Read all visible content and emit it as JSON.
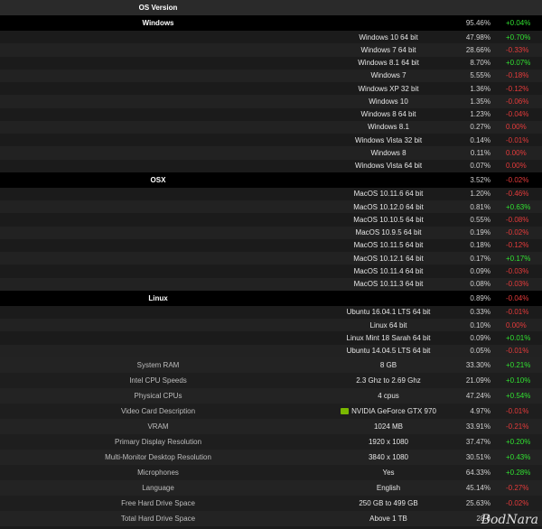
{
  "header": {
    "title": "OS Version"
  },
  "sections": [
    {
      "name": "Windows",
      "pct": "95.46%",
      "change": "+0.04%",
      "rows": [
        {
          "name": "Windows 10 64 bit",
          "pct": "47.98%",
          "change": "+0.70%"
        },
        {
          "name": "Windows 7 64 bit",
          "pct": "28.66%",
          "change": "-0.33%"
        },
        {
          "name": "Windows 8.1 64 bit",
          "pct": "8.70%",
          "change": "+0.07%"
        },
        {
          "name": "Windows 7",
          "pct": "5.55%",
          "change": "-0.18%"
        },
        {
          "name": "Windows XP 32 bit",
          "pct": "1.36%",
          "change": "-0.12%"
        },
        {
          "name": "Windows 10",
          "pct": "1.35%",
          "change": "-0.06%"
        },
        {
          "name": "Windows 8 64 bit",
          "pct": "1.23%",
          "change": "-0.04%"
        },
        {
          "name": "Windows 8.1",
          "pct": "0.27%",
          "change": "0.00%"
        },
        {
          "name": "Windows Vista 32 bit",
          "pct": "0.14%",
          "change": "-0.01%"
        },
        {
          "name": "Windows 8",
          "pct": "0.11%",
          "change": "0.00%"
        },
        {
          "name": "Windows Vista 64 bit",
          "pct": "0.07%",
          "change": "0.00%"
        }
      ]
    },
    {
      "name": "OSX",
      "pct": "3.52%",
      "change": "-0.02%",
      "rows": [
        {
          "name": "MacOS 10.11.6 64 bit",
          "pct": "1.20%",
          "change": "-0.46%"
        },
        {
          "name": "MacOS 10.12.0 64 bit",
          "pct": "0.81%",
          "change": "+0.63%"
        },
        {
          "name": "MacOS 10.10.5 64 bit",
          "pct": "0.55%",
          "change": "-0.08%"
        },
        {
          "name": "MacOS 10.9.5 64 bit",
          "pct": "0.19%",
          "change": "-0.02%"
        },
        {
          "name": "MacOS 10.11.5 64 bit",
          "pct": "0.18%",
          "change": "-0.12%"
        },
        {
          "name": "MacOS 10.12.1 64 bit",
          "pct": "0.17%",
          "change": "+0.17%"
        },
        {
          "name": "MacOS 10.11.4 64 bit",
          "pct": "0.09%",
          "change": "-0.03%"
        },
        {
          "name": "MacOS 10.11.3 64 bit",
          "pct": "0.08%",
          "change": "-0.03%"
        }
      ]
    },
    {
      "name": "Linux",
      "pct": "0.89%",
      "change": "-0.04%",
      "rows": [
        {
          "name": "Ubuntu 16.04.1 LTS 64 bit",
          "pct": "0.33%",
          "change": "-0.01%"
        },
        {
          "name": "Linux 64 bit",
          "pct": "0.10%",
          "change": "0.00%"
        },
        {
          "name": "Linux Mint 18 Sarah 64 bit",
          "pct": "0.09%",
          "change": "+0.01%"
        },
        {
          "name": "Ubuntu 14.04.5 LTS 64 bit",
          "pct": "0.05%",
          "change": "-0.01%"
        }
      ]
    }
  ],
  "summary": [
    {
      "metric": "System RAM",
      "value": "8 GB",
      "pct": "33.30%",
      "change": "+0.21%"
    },
    {
      "metric": "Intel CPU Speeds",
      "value": "2.3 Ghz to 2.69 Ghz",
      "pct": "21.09%",
      "change": "+0.10%"
    },
    {
      "metric": "Physical CPUs",
      "value": "4 cpus",
      "pct": "47.24%",
      "change": "+0.54%"
    },
    {
      "metric": "Video Card Description",
      "value": "NVIDIA GeForce GTX 970",
      "pct": "4.97%",
      "change": "-0.01%",
      "icon": "nvidia-icon"
    },
    {
      "metric": "VRAM",
      "value": "1024 MB",
      "pct": "33.91%",
      "change": "-0.21%"
    },
    {
      "metric": "Primary Display Resolution",
      "value": "1920 x 1080",
      "pct": "37.47%",
      "change": "+0.20%"
    },
    {
      "metric": "Multi-Monitor Desktop Resolution",
      "value": "3840 x 1080",
      "pct": "30.51%",
      "change": "+0.43%"
    },
    {
      "metric": "Microphones",
      "value": "Yes",
      "pct": "64.33%",
      "change": "+0.28%"
    },
    {
      "metric": "Language",
      "value": "English",
      "pct": "45.14%",
      "change": "-0.27%"
    },
    {
      "metric": "Free Hard Drive Space",
      "value": "250 GB to 499 GB",
      "pct": "25.63%",
      "change": "-0.02%"
    },
    {
      "metric": "Total Hard Drive Space",
      "value": "Above 1 TB",
      "pct": "28.6",
      "change": ""
    }
  ],
  "watermark": "BodNara",
  "colors": {
    "positive": "#31e031",
    "negative": "#e63b3b",
    "section_bg": "#000000"
  }
}
